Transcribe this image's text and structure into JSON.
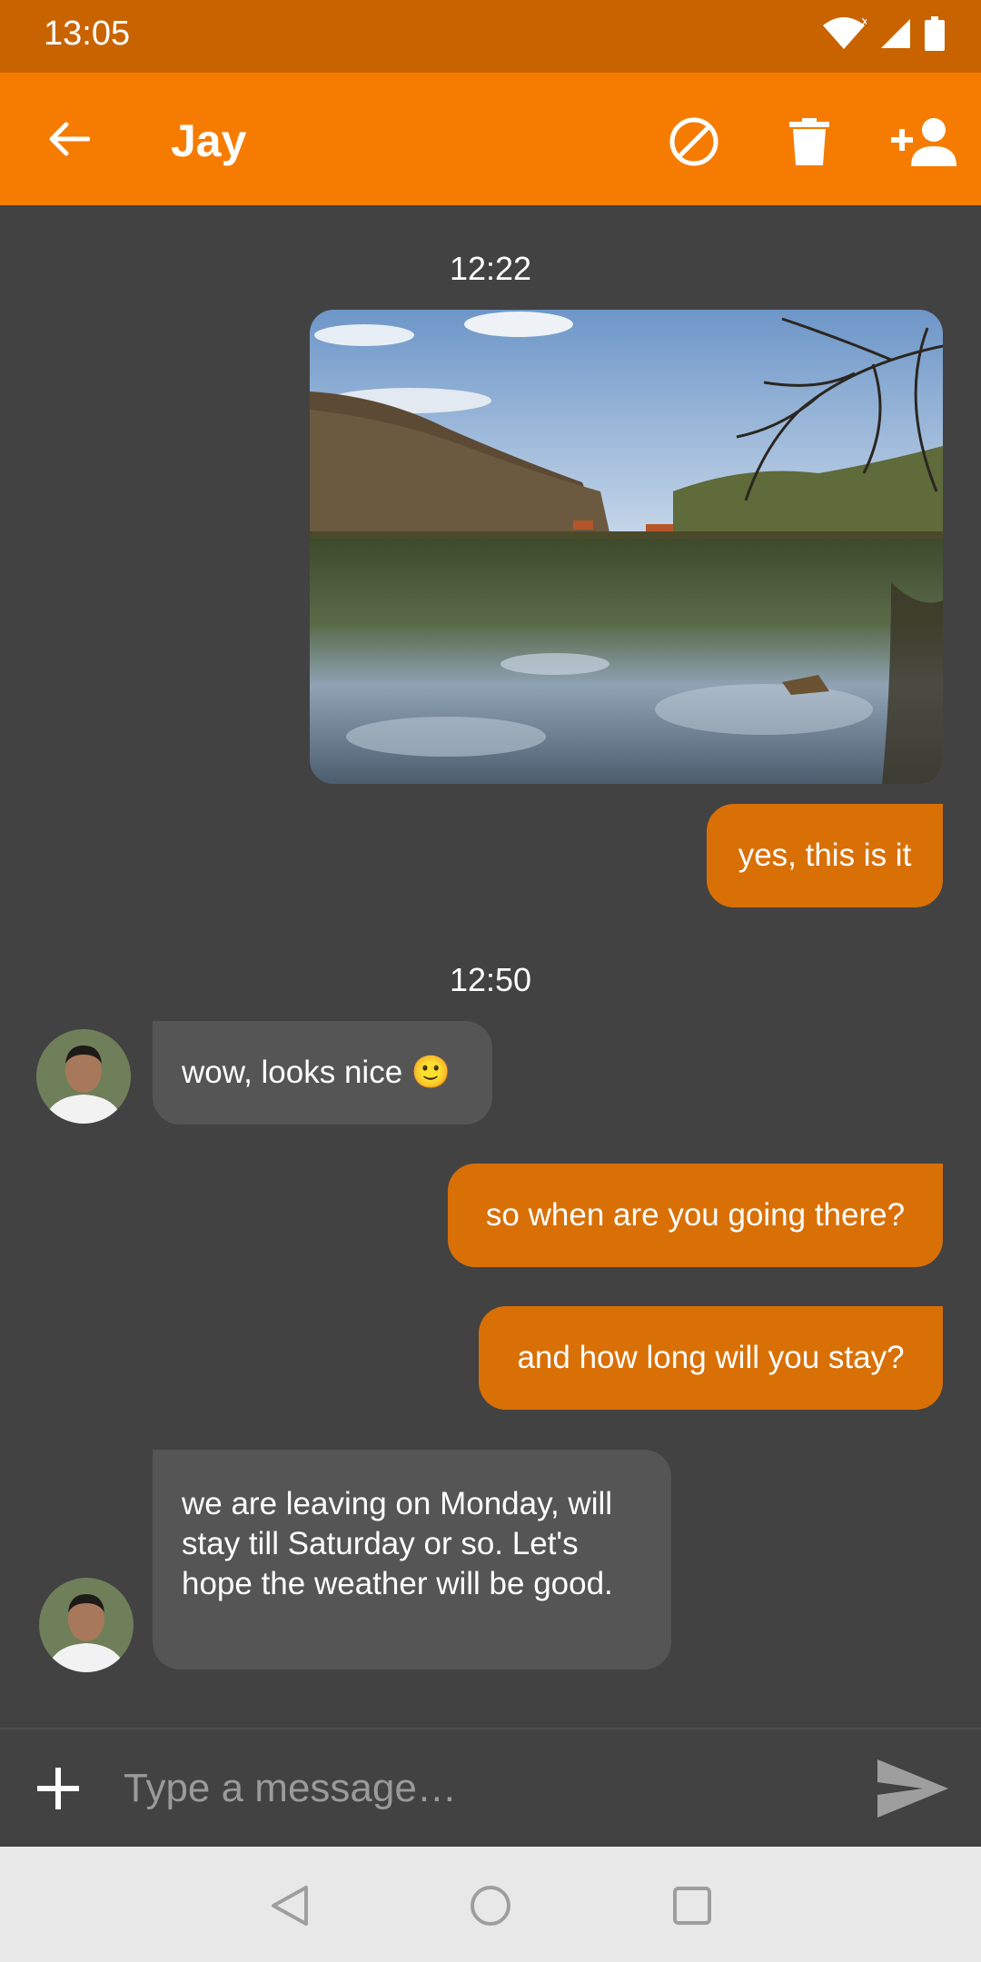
{
  "status_bar": {
    "time": "13:05"
  },
  "header": {
    "contact_name": "Jay"
  },
  "conversation": {
    "separators": [
      "12:22",
      "12:50"
    ],
    "messages": [
      {
        "direction": "outgoing",
        "text": "yes, this is it"
      },
      {
        "direction": "incoming",
        "text": "wow, looks nice 🙂"
      },
      {
        "direction": "outgoing",
        "text": "so when are you going there?"
      },
      {
        "direction": "outgoing",
        "text": "and how long will you stay?"
      },
      {
        "direction": "incoming",
        "text": "we are leaving on Monday, will stay till Saturday or so. Let's hope the weather will be good."
      }
    ]
  },
  "composer": {
    "placeholder": "Type a message…"
  },
  "colors": {
    "status_bar": "#c96300",
    "app_bar": "#f57c00",
    "outgoing_bubble": "#d97006",
    "incoming_bubble": "#555555",
    "background": "#424242"
  },
  "icons": [
    "back-arrow-icon",
    "block-icon",
    "delete-icon",
    "add-person-icon",
    "plus-icon",
    "send-icon",
    "nav-back-icon",
    "nav-home-icon",
    "nav-recents-icon",
    "wifi-icon",
    "signal-icon",
    "battery-icon"
  ]
}
